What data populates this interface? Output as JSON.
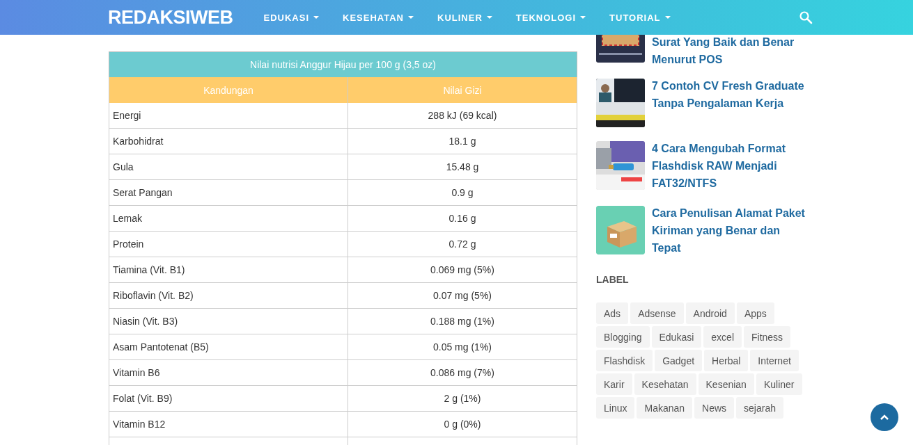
{
  "header": {
    "logo": "REDAKSIWEB",
    "menu": [
      {
        "label": "EDUKASI",
        "has_dropdown": true
      },
      {
        "label": "KESEHATAN",
        "has_dropdown": true
      },
      {
        "label": "KULINER",
        "has_dropdown": true
      },
      {
        "label": "TEKNOLOGI",
        "has_dropdown": true
      },
      {
        "label": "TUTORIAL",
        "has_dropdown": true
      }
    ]
  },
  "table": {
    "caption": "Nilai nutrisi Anggur Hijau per 100 g (3,5 oz)",
    "columns": [
      "Kandungan",
      "Nilai Gizi"
    ],
    "rows": [
      [
        "Energi",
        "288 kJ (69 kcal)"
      ],
      [
        "Karbohidrat",
        "18.1 g"
      ],
      [
        "Gula",
        "15.48 g"
      ],
      [
        "Serat Pangan",
        "0.9 g"
      ],
      [
        "Lemak",
        "0.16 g"
      ],
      [
        "Protein",
        "0.72 g"
      ],
      [
        "Tiamina (Vit. B1)",
        "0.069 mg (5%)"
      ],
      [
        "Riboflavin (Vit. B2)",
        "0.07 mg (5%)"
      ],
      [
        "Niasin (Vit. B3)",
        "0.188 mg (1%)"
      ],
      [
        "Asam Pantotenat (B5)",
        "0.05 mg (1%)"
      ],
      [
        "Vitamin B6",
        "0.086 mg (7%)"
      ],
      [
        "Folat (Vit. B9)",
        "2 g (1%)"
      ],
      [
        "Vitamin B12",
        "0 g (0%)"
      ]
    ]
  },
  "sidebar": {
    "posts": [
      {
        "title": "Surat Yang Baik dan Benar Menurut POS"
      },
      {
        "title": "7 Contoh CV Fresh Graduate Tanpa Pengalaman Kerja"
      },
      {
        "title": "4 Cara Mengubah Format Flashdisk RAW Menjadi FAT32/NTFS"
      },
      {
        "title": "Cara Penulisan Alamat Paket Kiriman yang Benar dan Tepat"
      }
    ],
    "label_heading": "LABEL",
    "labels": [
      "Ads",
      "Adsense",
      "Android",
      "Apps",
      "Blogging",
      "Edukasi",
      "excel",
      "Fitness",
      "Flashdisk",
      "Gadget",
      "Herbal",
      "Internet",
      "Karir",
      "Kesehatan",
      "Kesenian",
      "Kuliner",
      "Linux",
      "Makanan",
      "News",
      "sejarah"
    ]
  }
}
